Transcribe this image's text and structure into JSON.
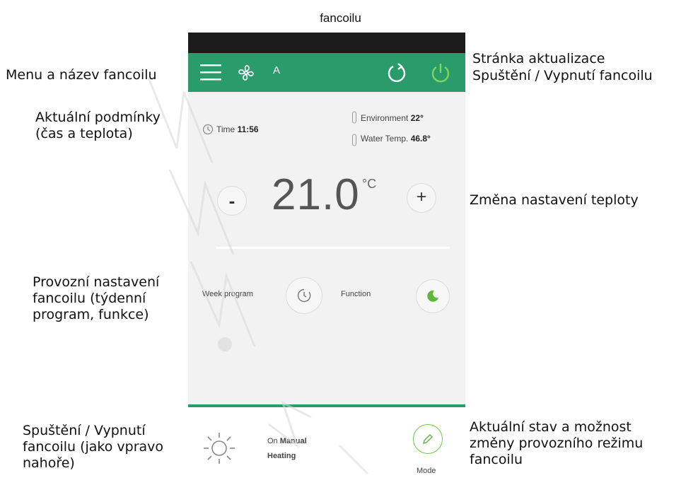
{
  "top_caption": "fancoilu",
  "captions": {
    "menu": "Menu a název fancoilu",
    "conditions": "Aktuální podmínky (čas a teplota)",
    "operation": "Provozní nastavení fancoilu (týdenní program, funkce)",
    "onoff_bottom": "Spuštění / Vypnutí fancoilu (jako vpravo nahoře)",
    "refresh_line1": "Stránka aktualizace",
    "refresh_line2": "Spuštění / Vypnutí fancoilu",
    "temp_change": "Změna nastavení teploty",
    "mode_line1": "Aktuální stav a možnost",
    "mode_line2": "změny provozního režimu",
    "mode_line3": "fancoilu"
  },
  "app": {
    "fancoil_name": "A",
    "time_label": "Time",
    "time_value": "11:56",
    "environment_label": "Environment",
    "environment_value": "22°",
    "water_label": "Water Temp.",
    "water_value": "46.8°",
    "minus": "-",
    "setpoint": "21.0",
    "unit": "°C",
    "plus": "+",
    "week_program": "Week program",
    "function": "Function",
    "state_on": "On",
    "state_mode": "Manual",
    "state_heating": "Heating",
    "mode_label": "Mode"
  },
  "colors": {
    "accent": "#2a9c6b",
    "power_green": "#6ccb3d",
    "statusbar": "#1b1b1b"
  },
  "icons": [
    "hamburger-icon",
    "fan-icon",
    "refresh-icon",
    "power-icon",
    "clock-icon",
    "thermometer-icon",
    "minus-icon",
    "plus-icon",
    "week-clock-icon",
    "moon-icon",
    "sun-icon",
    "pencil-icon"
  ]
}
